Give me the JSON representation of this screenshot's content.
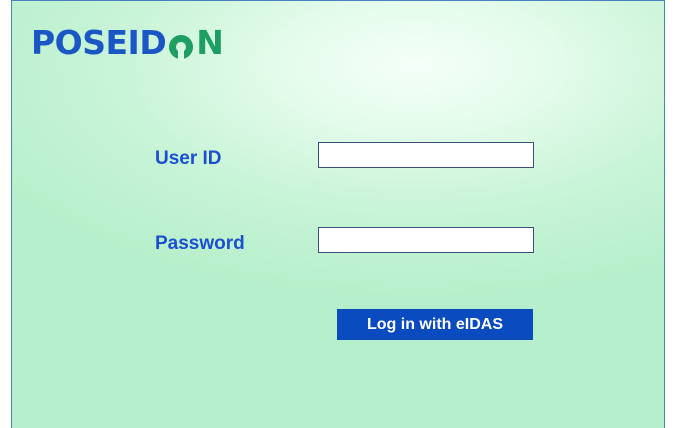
{
  "logo": {
    "part1": "POSEID",
    "part2": "N"
  },
  "form": {
    "user_id_label": "User ID",
    "user_id_value": "",
    "password_label": "Password",
    "password_value": "",
    "login_button_label": "Log in with eIDAS"
  },
  "colors": {
    "brand_blue": "#1a56c4",
    "brand_green": "#1f9e64",
    "label_blue": "#1a4fcf",
    "button_blue": "#0a4bc0",
    "background_mint": "#c9f4d8"
  },
  "icons": {
    "logo_o": "keyhole-o-icon"
  }
}
